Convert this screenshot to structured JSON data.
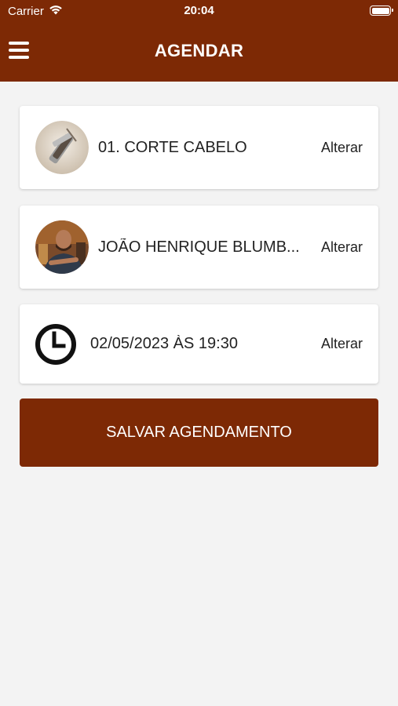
{
  "status_bar": {
    "carrier": "Carrier",
    "time": "20:04"
  },
  "header": {
    "title": "AGENDAR",
    "menu_icon": "hamburger-menu-icon"
  },
  "service": {
    "label": "01. CORTE CABELO",
    "action": "Alterar"
  },
  "professional": {
    "label": "JOÃO HENRIQUE BLUMB...",
    "action": "Alterar"
  },
  "datetime": {
    "label": "02/05/2023 ÀS 19:30",
    "action": "Alterar",
    "icon": "clock-icon"
  },
  "save_button": {
    "label": "SALVAR AGENDAMENTO"
  },
  "colors": {
    "brand": "#7d2905",
    "background": "#f3f3f3"
  }
}
